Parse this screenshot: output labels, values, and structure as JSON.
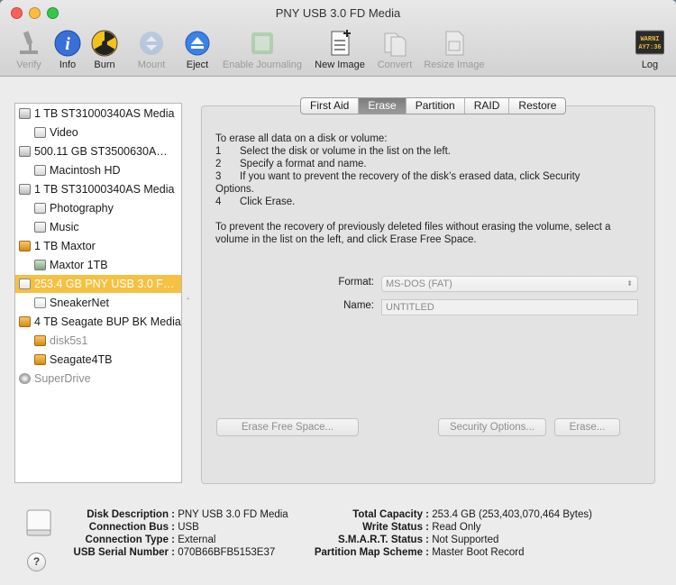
{
  "window": {
    "title": "PNY USB 3.0 FD Media"
  },
  "toolbar": [
    {
      "key": "verify",
      "label": "Verify",
      "enabled": false,
      "icon": "microscope-icon"
    },
    {
      "key": "info",
      "label": "Info",
      "enabled": true,
      "icon": "info-icon"
    },
    {
      "key": "burn",
      "label": "Burn",
      "enabled": true,
      "icon": "radiation-icon"
    },
    {
      "key": "mount",
      "label": "Mount",
      "enabled": false,
      "icon": "mount-icon"
    },
    {
      "key": "eject",
      "label": "Eject",
      "enabled": true,
      "icon": "eject-icon"
    },
    {
      "key": "journaling",
      "label": "Enable Journaling",
      "enabled": false,
      "icon": "journaling-icon"
    },
    {
      "key": "newimage",
      "label": "New Image",
      "enabled": true,
      "icon": "new-image-icon"
    },
    {
      "key": "convert",
      "label": "Convert",
      "enabled": false,
      "icon": "convert-icon"
    },
    {
      "key": "resize",
      "label": "Resize Image",
      "enabled": false,
      "icon": "resize-image-icon"
    },
    {
      "key": "log",
      "label": "Log",
      "enabled": true,
      "icon": "log-icon",
      "screen_text": "WARNI\nAY7:36"
    }
  ],
  "sidebar": {
    "items": [
      {
        "label": "1 TB ST31000340AS Media",
        "level": 0,
        "icon": "disk"
      },
      {
        "label": "Video",
        "level": 1,
        "icon": "vol"
      },
      {
        "label": "500.11 GB ST3500630A…",
        "level": 0,
        "icon": "disk"
      },
      {
        "label": "Macintosh HD",
        "level": 1,
        "icon": "vol"
      },
      {
        "label": "1 TB ST31000340AS Media",
        "level": 0,
        "icon": "disk"
      },
      {
        "label": "Photography",
        "level": 1,
        "icon": "vol"
      },
      {
        "label": "Music",
        "level": 1,
        "icon": "vol"
      },
      {
        "label": "1 TB Maxtor",
        "level": 0,
        "icon": "orange"
      },
      {
        "label": "Maxtor 1TB",
        "level": 1,
        "icon": "net"
      },
      {
        "label": "253.4 GB PNY USB 3.0 F…",
        "level": 0,
        "icon": "usb",
        "selected": true
      },
      {
        "label": "SneakerNet",
        "level": 1,
        "icon": "usb"
      },
      {
        "label": "4 TB Seagate BUP BK Media",
        "level": 0,
        "icon": "orange"
      },
      {
        "label": "disk5s1",
        "level": 1,
        "icon": "orange",
        "dim": true
      },
      {
        "label": "Seagate4TB",
        "level": 1,
        "icon": "orange"
      },
      {
        "label": "SuperDrive",
        "level": 0,
        "icon": "dvd",
        "dim": true
      }
    ]
  },
  "tabs": [
    {
      "label": "First Aid",
      "active": false
    },
    {
      "label": "Erase",
      "active": true
    },
    {
      "label": "Partition",
      "active": false
    },
    {
      "label": "RAID",
      "active": false
    },
    {
      "label": "Restore",
      "active": false
    }
  ],
  "erase": {
    "intro": "To erase all data on a disk or volume:",
    "steps": [
      {
        "n": "1",
        "text": "Select the disk or volume in the list on the left."
      },
      {
        "n": "2",
        "text": "Specify a format and name."
      },
      {
        "n": "3",
        "text": "If you want to prevent the recovery of the disk’s erased data, click Security"
      },
      {
        "n": "",
        "text": "Options."
      },
      {
        "n": "4",
        "text": "Click Erase."
      }
    ],
    "free_space_line1": "To prevent the recovery of previously deleted files without erasing the volume, select a",
    "free_space_line2": "volume in the list on the left, and click Erase Free Space.",
    "format_label": "Format:",
    "format_value": "MS-DOS (FAT)",
    "name_label": "Name:",
    "name_value": "UNTITLED",
    "erase_free_space_button": "Erase Free Space...",
    "security_options_button": "Security Options...",
    "erase_button": "Erase..."
  },
  "info": {
    "left": [
      {
        "label": "Disk Description :",
        "value": "PNY USB 3.0 FD Media"
      },
      {
        "label": "Connection Bus :",
        "value": "USB"
      },
      {
        "label": "Connection Type :",
        "value": "External"
      },
      {
        "label": "USB Serial Number :",
        "value": "070B66BFB5153E37"
      }
    ],
    "right": [
      {
        "label": "Total Capacity :",
        "value": "253.4 GB (253,403,070,464 Bytes)"
      },
      {
        "label": "Write Status :",
        "value": "Read Only"
      },
      {
        "label": "S.M.A.R.T. Status :",
        "value": "Not Supported"
      },
      {
        "label": "Partition Map Scheme :",
        "value": "Master Boot Record"
      }
    ],
    "help_label": "?"
  },
  "colors": {
    "selection": "#f6c142",
    "info_blue": "#3a6fd8",
    "eject_blue": "#3b82e6"
  }
}
